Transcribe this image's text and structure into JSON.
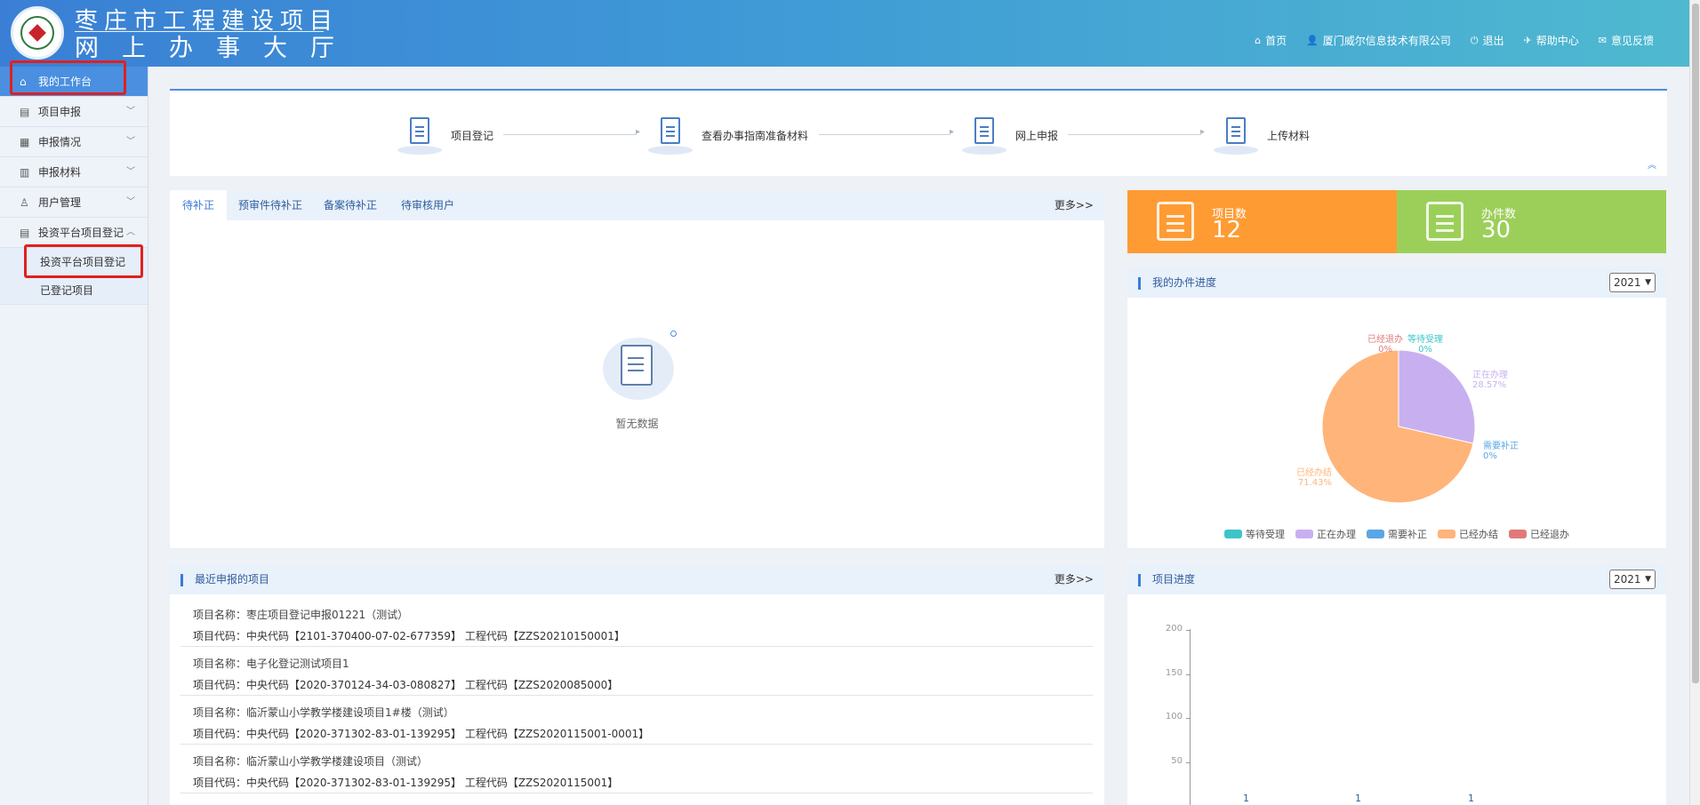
{
  "header": {
    "title_line1": "枣庄市工程建设项目",
    "title_line2": "网上办事大厅",
    "nav": [
      {
        "label": "首页",
        "icon": "home-icon",
        "glyph": "⌂"
      },
      {
        "label": "厦门威尔信息技术有限公司",
        "icon": "user-icon",
        "glyph": "👤"
      },
      {
        "label": "退出",
        "icon": "power-icon",
        "glyph": "⏻"
      },
      {
        "label": "帮助中心",
        "icon": "help-icon",
        "glyph": "✈"
      },
      {
        "label": "意见反馈",
        "icon": "feedback-icon",
        "glyph": "✉"
      }
    ]
  },
  "sidebar": {
    "items": [
      {
        "label": "我的工作台",
        "glyph": "⌂"
      },
      {
        "label": "项目申报",
        "glyph": "▤"
      },
      {
        "label": "申报情况",
        "glyph": "▦"
      },
      {
        "label": "申报材料",
        "glyph": "▥"
      },
      {
        "label": "用户管理",
        "glyph": "♙"
      },
      {
        "label": "投资平台项目登记",
        "glyph": "▤"
      }
    ],
    "sub_items": [
      "投资平台项目登记",
      "已登记项目"
    ]
  },
  "steps": [
    "项目登记",
    "查看办事指南准备材料",
    "网上申报",
    "上传材料"
  ],
  "tabs": {
    "items": [
      "待补正",
      "预审件待补正",
      "备案待补正",
      "待审核用户"
    ],
    "more": "更多>>",
    "empty_text": "暂无数据"
  },
  "stats": {
    "projects_label": "项目数",
    "projects_value": "12",
    "cases_label": "办件数",
    "cases_value": "30"
  },
  "progress": {
    "title": "我的办件进度",
    "year": "2021",
    "chart_data": {
      "type": "pie",
      "labels": [
        "等待受理",
        "正在办理",
        "需要补正",
        "已经办结",
        "已经退办"
      ],
      "values": [
        0,
        28.57,
        0,
        71.43,
        0
      ],
      "value_labels": [
        "0%",
        "28.57%",
        "0%",
        "71.43%",
        "0%"
      ],
      "colors": [
        "#3dc4c9",
        "#c8b0f0",
        "#5aa6e6",
        "#ffb47a",
        "#e07a7a"
      ],
      "legend": "bottom"
    }
  },
  "recent": {
    "title": "最近申报的项目",
    "more": "更多>>",
    "items": [
      {
        "name": "项目名称：枣庄项目登记申报01221（测试）",
        "code": "项目代码：中央代码【2101-370400-07-02-677359】   工程代码【ZZS20210150001】"
      },
      {
        "name": "项目名称：电子化登记测试项目1",
        "code": "项目代码：中央代码【2020-370124-34-03-080827】   工程代码【ZZS2020085000】"
      },
      {
        "name": "项目名称：临沂蒙山小学教学楼建设项目1#楼（测试）",
        "code": "项目代码：中央代码【2020-371302-83-01-139295】   工程代码【ZZS2020115001-0001】"
      },
      {
        "name": "项目名称：临沂蒙山小学教学楼建设项目（测试）",
        "code": "项目代码：中央代码【2020-371302-83-01-139295】   工程代码【ZZS2020115001】"
      }
    ]
  },
  "project_progress": {
    "title": "项目进度",
    "year": "2021",
    "chart_data": {
      "type": "bar",
      "ylim": [
        0,
        200
      ],
      "y_ticks": [
        "200",
        "150",
        "100",
        "50"
      ],
      "value_labels": [
        "1",
        "1",
        "1"
      ],
      "values": [
        1,
        1,
        1
      ]
    }
  }
}
